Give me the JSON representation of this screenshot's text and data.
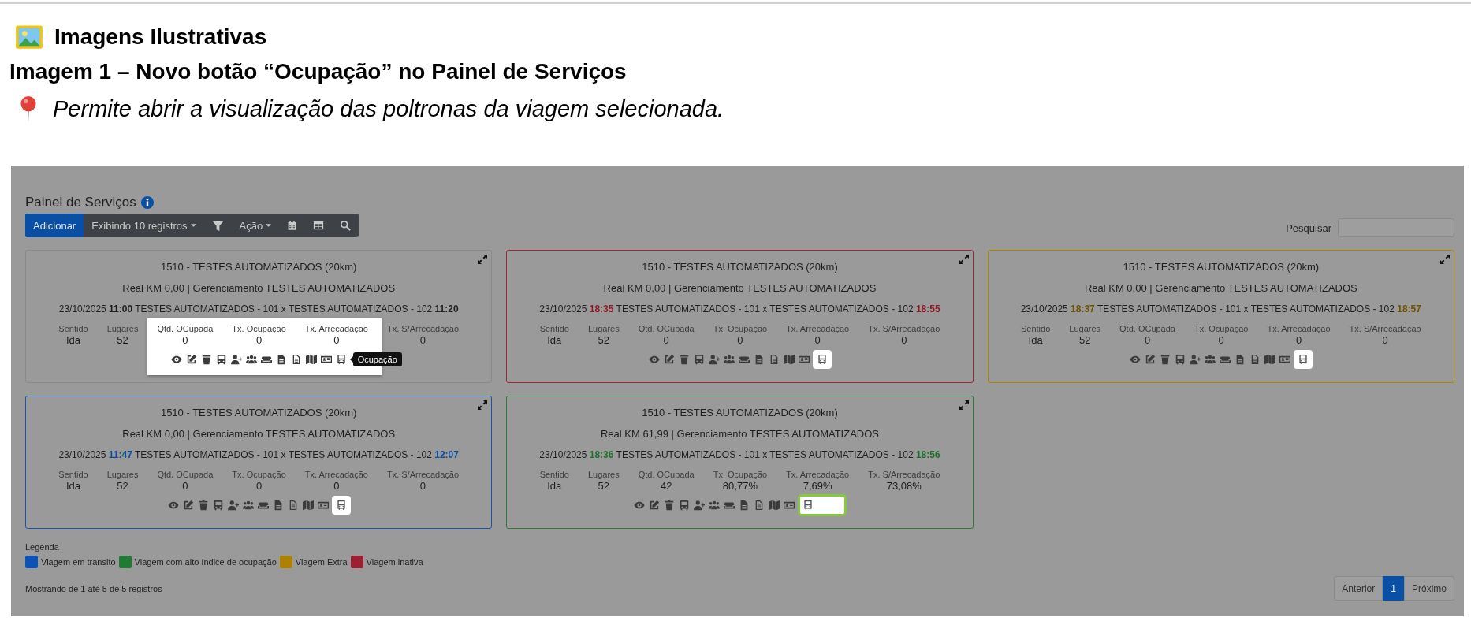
{
  "document": {
    "heading": "Imagens Ilustrativas",
    "caption_title": "Imagem 1 – Novo botão “Ocupação” no Painel de Serviços",
    "caption_text": "Permite abrir a visualização das poltronas da viagem selecionada."
  },
  "panel": {
    "title": "Painel de Serviços",
    "toolbar": {
      "add": "Adicionar",
      "page_size": "Exibindo 10 registros",
      "action": "Ação"
    },
    "search": {
      "label": "Pesquisar"
    }
  },
  "cards": [
    {
      "kind": "default",
      "spotlighted": true,
      "button_highlighted": false,
      "focused": false,
      "title": "1510 - TESTES AUTOMATIZADOS (20km)",
      "info": "Real KM 0,00 | Gerenciamento TESTES AUTOMATIZADOS",
      "date": "23/10/2025",
      "departure": "11:00",
      "route": "TESTES AUTOMATIZADOS - 101 x TESTES AUTOMATIZADOS - 102",
      "arrival": "11:20",
      "stats": [
        {
          "label": "Sentido",
          "value": "Ida"
        },
        {
          "label": "Lugares",
          "value": "52"
        },
        {
          "label": "Qtd. OCupada",
          "value": "0"
        },
        {
          "label": "Tx. Ocupação",
          "value": "0"
        },
        {
          "label": "Tx. Arrecadação",
          "value": "0"
        },
        {
          "label": "Tx. S/Arrecadação",
          "value": "0"
        }
      ],
      "tooltip": "Ocupação"
    },
    {
      "kind": "inactive",
      "spotlighted": false,
      "button_highlighted": true,
      "focused": false,
      "title": "1510 - TESTES AUTOMATIZADOS (20km)",
      "info": "Real KM 0,00 | Gerenciamento TESTES AUTOMATIZADOS",
      "date": "23/10/2025",
      "departure": "18:35",
      "route": "TESTES AUTOMATIZADOS - 101 x TESTES AUTOMATIZADOS - 102",
      "arrival": "18:55",
      "stats": [
        {
          "label": "Sentido",
          "value": "Ida"
        },
        {
          "label": "Lugares",
          "value": "52"
        },
        {
          "label": "Qtd. OCupada",
          "value": "0"
        },
        {
          "label": "Tx. Ocupação",
          "value": "0"
        },
        {
          "label": "Tx. Arrecadação",
          "value": "0"
        },
        {
          "label": "Tx. S/Arrecadação",
          "value": "0"
        }
      ]
    },
    {
      "kind": "extra",
      "spotlighted": false,
      "button_highlighted": true,
      "focused": false,
      "title": "1510 - TESTES AUTOMATIZADOS (20km)",
      "info": "Real KM 0,00 | Gerenciamento TESTES AUTOMATIZADOS",
      "date": "23/10/2025",
      "departure": "18:37",
      "route": "TESTES AUTOMATIZADOS - 101 x TESTES AUTOMATIZADOS - 102",
      "arrival": "18:57",
      "stats": [
        {
          "label": "Sentido",
          "value": "Ida"
        },
        {
          "label": "Lugares",
          "value": "52"
        },
        {
          "label": "Qtd. OCupada",
          "value": "0"
        },
        {
          "label": "Tx. Ocupação",
          "value": "0"
        },
        {
          "label": "Tx. Arrecadação",
          "value": "0"
        },
        {
          "label": "Tx. S/Arrecadação",
          "value": "0"
        }
      ]
    },
    {
      "kind": "transit",
      "spotlighted": false,
      "button_highlighted": true,
      "focused": false,
      "title": "1510 - TESTES AUTOMATIZADOS (20km)",
      "info": "Real KM 0,00 | Gerenciamento TESTES AUTOMATIZADOS",
      "date": "23/10/2025",
      "departure": "11:47",
      "route": "TESTES AUTOMATIZADOS - 101 x TESTES AUTOMATIZADOS - 102",
      "arrival": "12:07",
      "stats": [
        {
          "label": "Sentido",
          "value": "Ida"
        },
        {
          "label": "Lugares",
          "value": "52"
        },
        {
          "label": "Qtd. OCupada",
          "value": "0"
        },
        {
          "label": "Tx. Ocupação",
          "value": "0"
        },
        {
          "label": "Tx. Arrecadação",
          "value": "0"
        },
        {
          "label": "Tx. S/Arrecadação",
          "value": "0"
        }
      ]
    },
    {
      "kind": "high",
      "spotlighted": false,
      "button_highlighted": false,
      "focused": true,
      "title": "1510 - TESTES AUTOMATIZADOS (20km)",
      "info": "Real KM 61,99 | Gerenciamento TESTES AUTOMATIZADOS",
      "date": "23/10/2025",
      "departure": "18:36",
      "route": "TESTES AUTOMATIZADOS - 101 x TESTES AUTOMATIZADOS - 102",
      "arrival": "18:56",
      "stats": [
        {
          "label": "Sentido",
          "value": "Ida"
        },
        {
          "label": "Lugares",
          "value": "52"
        },
        {
          "label": "Qtd. OCupada",
          "value": "42"
        },
        {
          "label": "Tx. Ocupação",
          "value": "80,77%"
        },
        {
          "label": "Tx. Arrecadação",
          "value": "7,69%"
        },
        {
          "label": "Tx. S/Arrecadação",
          "value": "73,08%"
        }
      ]
    }
  ],
  "legend": {
    "title": "Legenda",
    "items": [
      {
        "label": "Viagem em transito",
        "color": "#0b52b4"
      },
      {
        "label": "Viagem com alto índice de ocupação",
        "color": "#1f7a35"
      },
      {
        "label": "Viagem Extra",
        "color": "#ad8200"
      },
      {
        "label": "Viagem inativa",
        "color": "#9c2030"
      }
    ]
  },
  "footer": {
    "summary": "Mostrando de 1 até 5 de 5 registros",
    "pages": [
      {
        "label": "Anterior",
        "selected": false
      },
      {
        "label": "1",
        "selected": true
      },
      {
        "label": "Próximo",
        "selected": false
      }
    ]
  }
}
